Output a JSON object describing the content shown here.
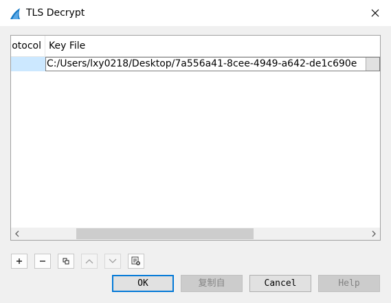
{
  "window": {
    "title": "TLS Decrypt"
  },
  "table": {
    "columns": [
      "otocol",
      "Key File"
    ],
    "rows": [
      {
        "protocol": "",
        "key_file": "C:/Users/lxy0218/Desktop/7a556a41-8cee-4949-a642-de1c690e"
      }
    ]
  },
  "toolbar": {
    "icons": [
      "add-icon",
      "remove-icon",
      "copy-icon",
      "move-up-icon",
      "move-down-icon",
      "clear-icon"
    ]
  },
  "buttons": {
    "ok": "OK",
    "copy_from": "复制自",
    "cancel": "Cancel",
    "help": "Help"
  },
  "colors": {
    "selection": "#cce8ff",
    "accent": "#0078d7"
  }
}
